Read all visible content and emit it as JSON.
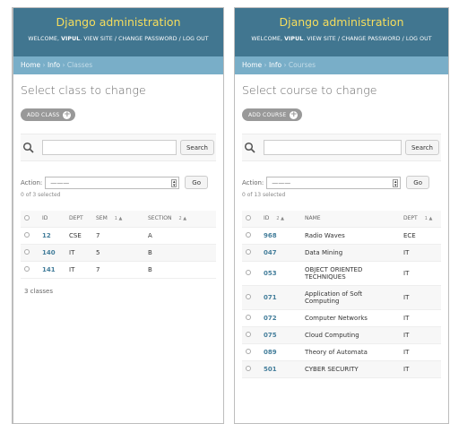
{
  "left": {
    "header": {
      "brand": "Django administration",
      "welcome": "WELCOME,",
      "user": "VIPUL",
      "links": ". VIEW SITE / CHANGE PASSWORD / LOG OUT"
    },
    "breadcrumbs": {
      "home": "Home",
      "sep1": " › ",
      "app": "Info",
      "sep2": " › ",
      "current": "Classes"
    },
    "title": "Select class to change",
    "add_button": "ADD CLASS",
    "search": {
      "button": "Search",
      "value": ""
    },
    "actions": {
      "label": "Action:",
      "selected": "———",
      "go": "Go",
      "count": "0 of 3 selected"
    },
    "columns": {
      "id": "ID",
      "dept": "DEPT",
      "sem": "SEM",
      "sem_sort": "1 ▲",
      "section": "SECTION",
      "section_sort": "2 ▲"
    },
    "rows": [
      {
        "id": "12",
        "dept": "CSE",
        "sem": "7",
        "section": "A"
      },
      {
        "id": "140",
        "dept": "IT",
        "sem": "5",
        "section": "B"
      },
      {
        "id": "141",
        "dept": "IT",
        "sem": "7",
        "section": "B"
      }
    ],
    "paginator": "3 classes"
  },
  "right": {
    "header": {
      "brand": "Django administration",
      "welcome": "WELCOME,",
      "user": "VIPUL",
      "links": ". VIEW SITE / CHANGE PASSWORD / LOG OUT"
    },
    "breadcrumbs": {
      "home": "Home",
      "sep1": " › ",
      "app": "Info",
      "sep2": " › ",
      "current": "Courses"
    },
    "title": "Select course to change",
    "add_button": "ADD COURSE",
    "search": {
      "button": "Search",
      "value": ""
    },
    "actions": {
      "label": "Action:",
      "selected": "———",
      "go": "Go",
      "count": "0 of 13 selected"
    },
    "columns": {
      "id": "ID",
      "id_sort": "2 ▲",
      "name": "NAME",
      "dept": "DEPT",
      "dept_sort": "1 ▲"
    },
    "rows": [
      {
        "id": "968",
        "name": "Radio Waves",
        "dept": "ECE"
      },
      {
        "id": "047",
        "name": "Data Mining",
        "dept": "IT"
      },
      {
        "id": "053",
        "name": "OBJECT ORIENTED TECHNIQUES",
        "dept": "IT"
      },
      {
        "id": "071",
        "name": "Application of Soft Computing",
        "dept": "IT"
      },
      {
        "id": "072",
        "name": "Computer Networks",
        "dept": "IT"
      },
      {
        "id": "075",
        "name": "Cloud Computing",
        "dept": "IT"
      },
      {
        "id": "089",
        "name": "Theory of Automata",
        "dept": "IT"
      },
      {
        "id": "501",
        "name": "CYBER SECURITY",
        "dept": "IT"
      }
    ]
  },
  "colors": {
    "header": "#417690",
    "brand": "#f5dd5d",
    "breadcrumbs": "#79aec8",
    "link": "#447e9b"
  }
}
